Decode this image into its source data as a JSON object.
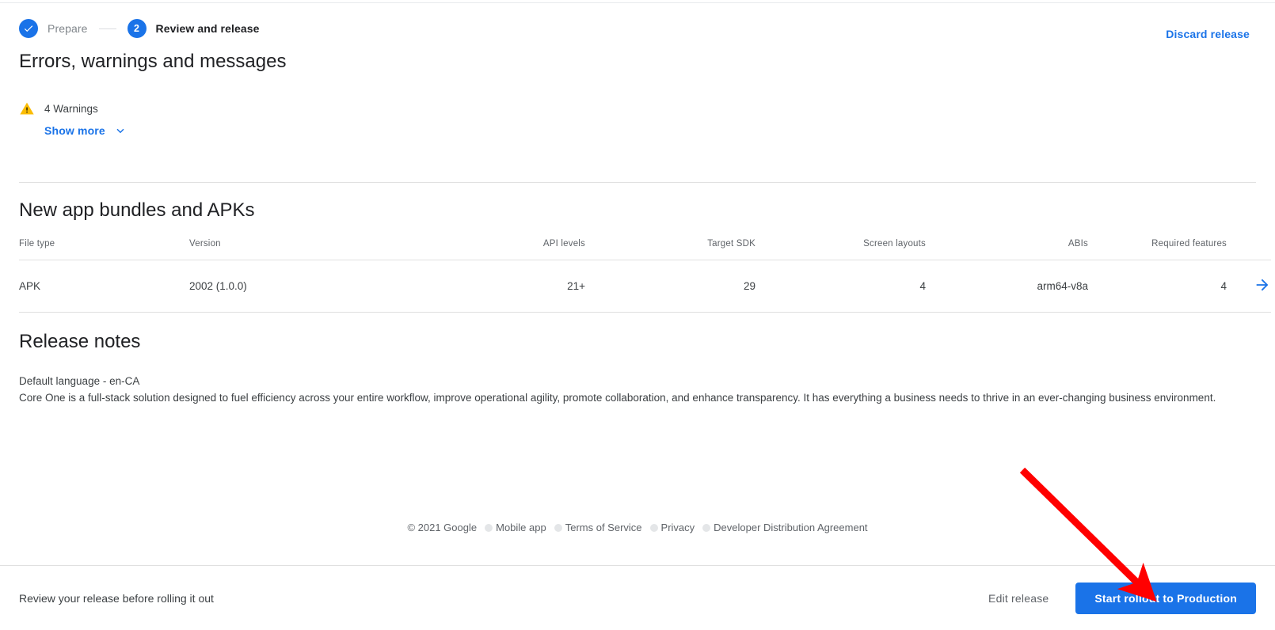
{
  "stepper": {
    "steps": [
      {
        "label": "Prepare",
        "state": "done",
        "marker": "check-icon"
      },
      {
        "label": "Review and release",
        "state": "current",
        "marker": "2"
      }
    ],
    "discard_label": "Discard release"
  },
  "messages": {
    "title": "Errors, warnings and messages",
    "warning_icon": "warning-triangle-icon",
    "warning_text": "4 Warnings",
    "show_more_label": "Show more",
    "chevron_icon": "chevron-down-icon"
  },
  "bundles": {
    "title": "New app bundles and APKs",
    "columns": [
      "File type",
      "Version",
      "API levels",
      "Target SDK",
      "Screen layouts",
      "ABIs",
      "Required features"
    ],
    "rows": [
      {
        "file_type": "APK",
        "version": "2002 (1.0.0)",
        "api_levels": "21+",
        "target_sdk": "29",
        "screen_layouts": "4",
        "abis": "arm64-v8a",
        "required_features": "4",
        "detail_icon": "arrow-right-icon"
      }
    ]
  },
  "release_notes": {
    "title": "Release notes",
    "language_line": "Default language - en-CA",
    "body": "Core One is a full-stack solution designed to fuel efficiency across your entire workflow, improve operational agility, promote collaboration, and enhance transparency. It has everything a business needs to thrive in an ever-changing business environment."
  },
  "footer": {
    "copyright": "© 2021 Google",
    "links": [
      "Mobile app",
      "Terms of Service",
      "Privacy",
      "Developer Distribution Agreement"
    ]
  },
  "action_bar": {
    "hint": "Review your release before rolling it out",
    "edit_label": "Edit release",
    "primary_label": "Start rollout to Production"
  },
  "annotation": {
    "type": "arrow",
    "color": "#FF0000",
    "points_to": "start-rollout-button"
  },
  "colors": {
    "accent_blue": "#1a73e8",
    "warning_amber": "#fbbc04",
    "text_primary": "#202124",
    "text_secondary": "#5f6368",
    "divider": "#e0e0e0",
    "annotation_red": "#FF0000"
  }
}
